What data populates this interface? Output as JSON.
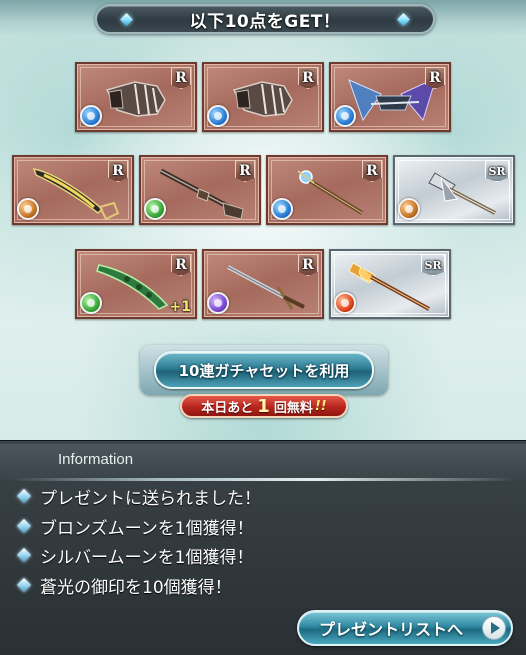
{
  "header": {
    "title": "以下10点をGET！"
  },
  "items": [
    {
      "name": "gauntlet",
      "rarity": "R",
      "element": "water",
      "plus": ""
    },
    {
      "name": "gauntlet",
      "rarity": "R",
      "element": "water",
      "plus": ""
    },
    {
      "name": "winged-crossbow",
      "rarity": "R",
      "element": "water",
      "plus": ""
    },
    {
      "name": "scimitar",
      "rarity": "R",
      "element": "earth",
      "plus": ""
    },
    {
      "name": "rifle",
      "rarity": "R",
      "element": "wind",
      "plus": ""
    },
    {
      "name": "staff",
      "rarity": "R",
      "element": "water",
      "plus": ""
    },
    {
      "name": "spear",
      "rarity": "SR",
      "element": "earth",
      "plus": ""
    },
    {
      "name": "leaf-blade",
      "rarity": "R",
      "element": "wind",
      "plus": "+1"
    },
    {
      "name": "longsword",
      "rarity": "R",
      "element": "dark",
      "plus": ""
    },
    {
      "name": "flame-lance",
      "rarity": "SR",
      "element": "fire",
      "plus": ""
    }
  ],
  "gacha": {
    "button_label": "10連ガチャセットを利用",
    "free_prefix": "本日あと",
    "free_count": "1",
    "free_suffix": "回無料",
    "free_mark": "!!"
  },
  "info": {
    "title": "Information",
    "lines": [
      "プレゼントに送られました！",
      "ブロンズムーンを1個獲得！",
      "シルバームーンを1個獲得！",
      "蒼光の御印を10個獲得！"
    ],
    "present_button": "プレゼントリストへ"
  },
  "colors": {
    "r_card": "#b07a6c",
    "sr_card": "#d3dbe1",
    "panel": "#2f363a",
    "accent": "#2f7e95"
  }
}
